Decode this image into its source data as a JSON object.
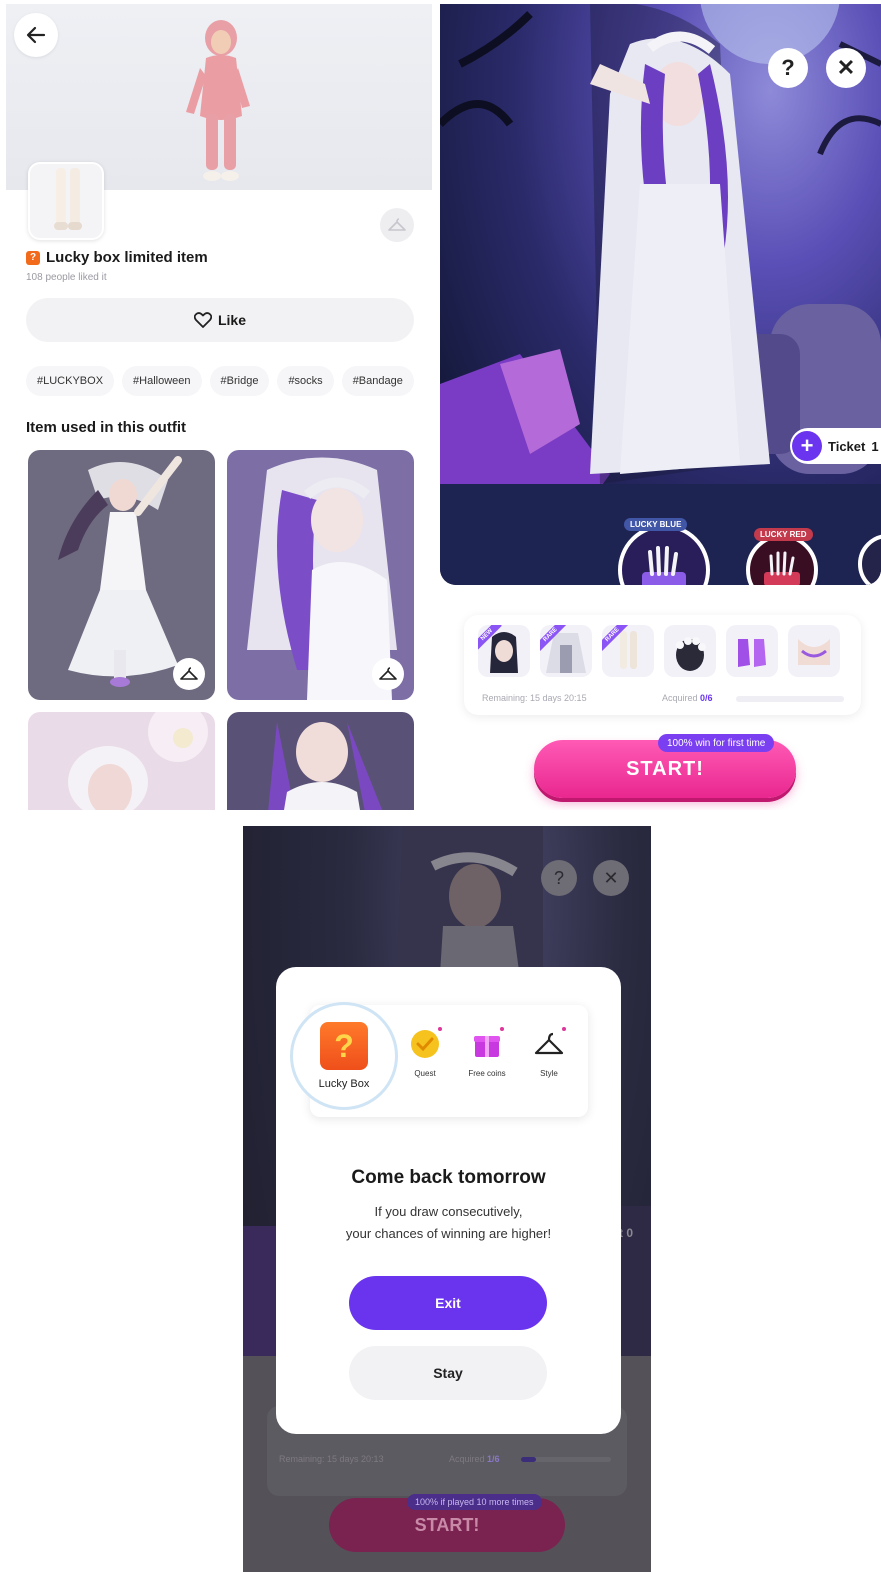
{
  "detail": {
    "title": "Lucky box limited item",
    "title_badge": "?",
    "likes_text": "108 people liked it",
    "like_button": "Like",
    "tags": [
      "#LUCKYBOX",
      "#Halloween",
      "#Bridge",
      "#socks",
      "#Bandage"
    ],
    "section_title": "Item used in this outfit",
    "icons": {
      "back": "back-arrow-icon",
      "hanger": "hanger-icon",
      "heart": "heart-icon"
    },
    "colors": {
      "badge": "#f26a1b"
    }
  },
  "draw": {
    "help_label": "?",
    "close_label": "✕",
    "ticket_label": "Ticket",
    "ticket_count": "1",
    "capsules": [
      {
        "label": "LUCKY BLUE",
        "color": "#5a7ad8"
      },
      {
        "label": "LUCKY RED",
        "color": "#e0405a"
      }
    ],
    "remaining": "Remaining: 15 days 20:15",
    "acquired_label": "Acquired",
    "acquired_value": "0/6",
    "acquired_fraction": 0,
    "item_badges": [
      "NEW",
      "RARE",
      "RARE"
    ],
    "start_label": "START!",
    "win_badge": "100% win for first time",
    "colors": {
      "accent": "#6b35f0",
      "start": "#e9278f"
    }
  },
  "dialog": {
    "lucky_box_label": "Lucky Box",
    "lucky_box_glyph": "?",
    "features": [
      {
        "label": "Quest",
        "icon": "quest-check-icon"
      },
      {
        "label": "Free coins",
        "icon": "gift-icon"
      },
      {
        "label": "Style",
        "icon": "hanger-icon"
      }
    ],
    "title": "Come back tomorrow",
    "body_line1": "If you draw consecutively,",
    "body_line2": "your chances of winning are higher!",
    "exit_label": "Exit",
    "stay_label": "Stay",
    "bg_help": "?",
    "bg_close": "✕",
    "bg_remaining": "Remaining: 15 days 20:13",
    "bg_acquired_label": "Acquired",
    "bg_acquired_value": "1/6",
    "bg_acquired_fraction": 0.17,
    "bg_ticket_count": "t 0",
    "bg_start": "START!",
    "bg_badge": "100% if played 10 more times",
    "colors": {
      "exit": "#6a34ef"
    }
  }
}
